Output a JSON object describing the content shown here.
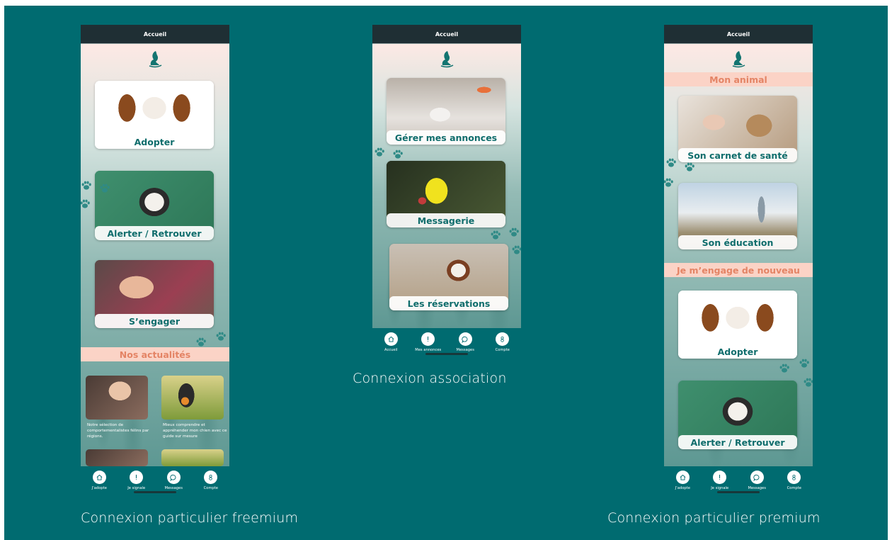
{
  "phones": {
    "freemium": {
      "header_title": "Accueil",
      "cards": [
        "Adopter",
        "Alerter / Retrouver",
        "S’engager"
      ],
      "section_title": "Nos actualités",
      "news": [
        "Notre sélection de comportementalistes félins par régions.",
        "Mieux comprendre et appréhender mon chien avec ce guide sur mesure"
      ],
      "tabs": [
        "J’adopte",
        "Je signale",
        "Messages",
        "Compte"
      ]
    },
    "association": {
      "header_title": "Accueil",
      "cards": [
        "Gérer mes annonces",
        "Messagerie",
        "Les réservations"
      ],
      "tabs": [
        "Accueil",
        "Mes annonces",
        "Messages",
        "Compte"
      ]
    },
    "premium": {
      "header_title": "Accueil",
      "section_1": "Mon animal",
      "cards_1": [
        "Son carnet de santé",
        "Son éducation"
      ],
      "section_2": "Je m’engage de nouveau",
      "cards_2": [
        "Adopter",
        "Alerter / Retrouver"
      ],
      "tabs": [
        "J’adopte",
        "Je signale",
        "Messages",
        "Compte"
      ]
    }
  },
  "captions": {
    "freemium": "Connexion particulier freemium",
    "association": "Connexion association",
    "premium": "Connexion particulier premium"
  },
  "icons": {
    "tab_1": "home-icon",
    "tab_2": "alert-icon",
    "tab_3": "chat-icon",
    "tab_4": "account-icon"
  },
  "colors": {
    "background": "#006b70",
    "card_text": "#0f6d6c",
    "section_band": "#fbd3c6",
    "section_text": "#e48465"
  }
}
